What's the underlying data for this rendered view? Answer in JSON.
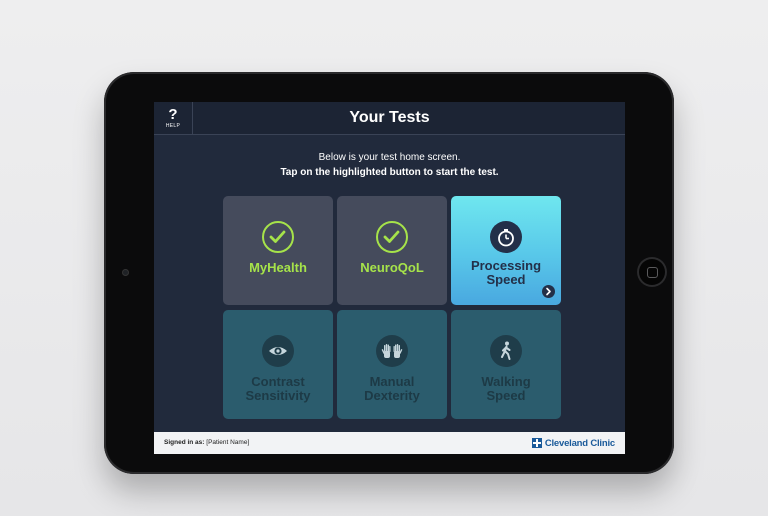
{
  "header": {
    "help_glyph": "?",
    "help_label": "HELP",
    "title": "Your Tests"
  },
  "instructions": {
    "line1": "Below is your test home screen.",
    "line2": "Tap on the highlighted button to start the test."
  },
  "tiles": [
    {
      "label": "MyHealth",
      "state": "completed",
      "icon": "check-icon"
    },
    {
      "label": "NeuroQoL",
      "state": "completed",
      "icon": "check-icon"
    },
    {
      "label": "Processing Speed",
      "state": "active",
      "icon": "stopwatch-icon"
    },
    {
      "label": "Contrast Sensitivity",
      "state": "locked",
      "icon": "eye-icon"
    },
    {
      "label": "Manual Dexterity",
      "state": "locked",
      "icon": "hands-icon"
    },
    {
      "label": "Walking Speed",
      "state": "locked",
      "icon": "walking-person-icon"
    }
  ],
  "footer": {
    "signed_in_label": "Signed in as:",
    "patient_name": "[Patient Name]",
    "logo_text": "Cleveland Clinic"
  },
  "colors": {
    "screen_bg": "#212a3c",
    "completed_tile": "#454b5c",
    "completed_accent": "#a6e34a",
    "active_tile": "#58c7e9",
    "locked_tile": "#2b5c6d",
    "brand_blue": "#1a5a9a"
  }
}
